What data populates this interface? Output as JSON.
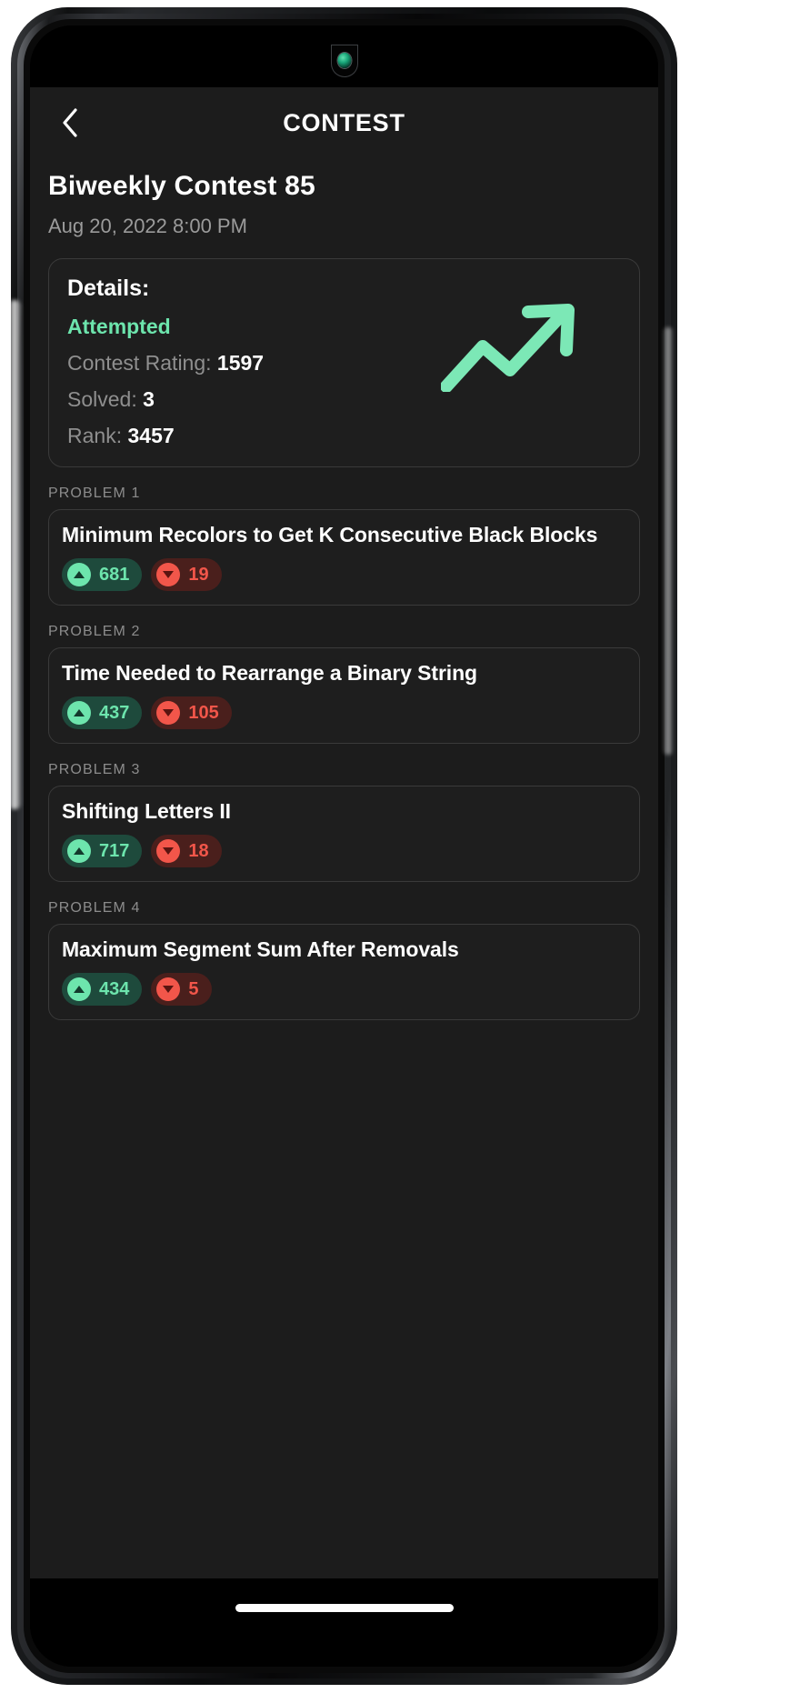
{
  "appbar": {
    "back_icon": "chevron-left-icon",
    "title": "CONTEST"
  },
  "contest": {
    "name": "Biweekly Contest 85",
    "datetime": "Aug 20, 2022 8:00 PM"
  },
  "details": {
    "heading": "Details:",
    "status": "Attempted",
    "rating_label": "Contest Rating:",
    "rating_value": "1597",
    "solved_label": "Solved:",
    "solved_value": "3",
    "rank_label": "Rank:",
    "rank_value": "3457",
    "trend_icon": "trending-up-arrow-icon"
  },
  "problems": [
    {
      "label": "PROBLEM 1",
      "title": "Minimum Recolors to Get K Consecutive Black Blocks",
      "upvotes": "681",
      "downvotes": "19"
    },
    {
      "label": "PROBLEM 2",
      "title": "Time Needed to Rearrange a Binary String",
      "upvotes": "437",
      "downvotes": "105"
    },
    {
      "label": "PROBLEM 3",
      "title": "Shifting Letters II",
      "upvotes": "717",
      "downvotes": "18"
    },
    {
      "label": "PROBLEM 4",
      "title": "Maximum Segment Sum After Removals",
      "upvotes": "434",
      "downvotes": "5"
    }
  ],
  "colors": {
    "accent_green": "#6de5ad",
    "accent_red": "#f2564a",
    "app_background": "#1c1c1c",
    "card_background": "#1e1e1e",
    "card_border": "#3a3a3a",
    "muted_text": "#8f8f8f"
  }
}
